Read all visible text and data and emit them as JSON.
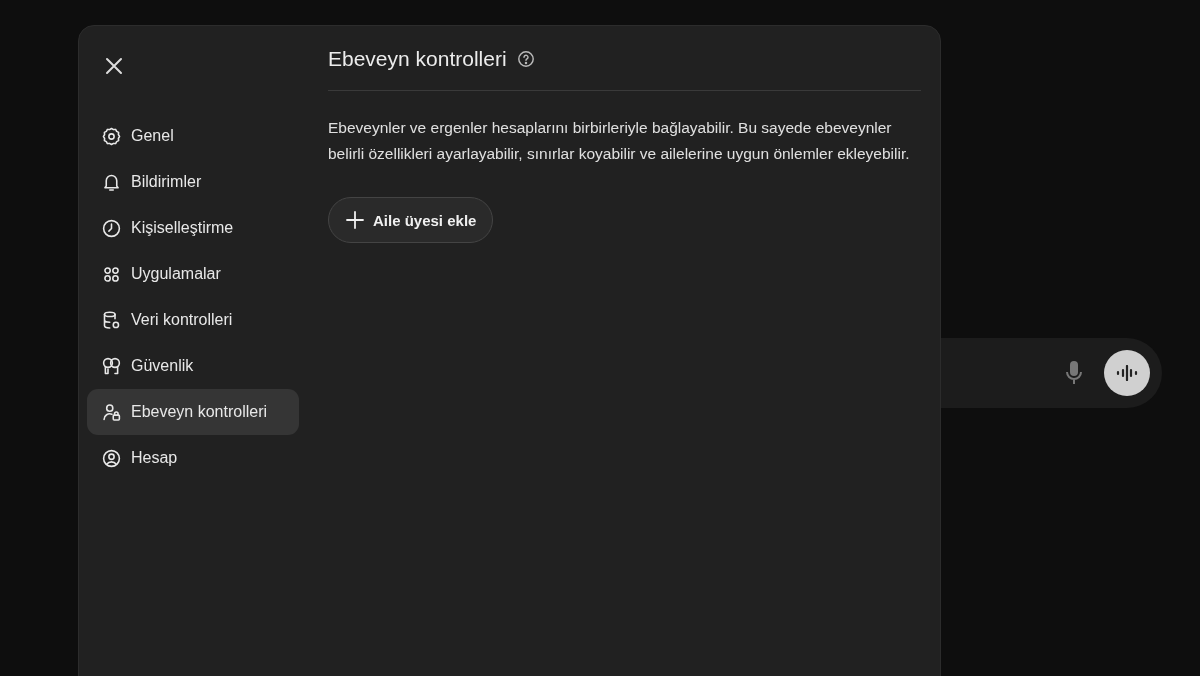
{
  "sidebar": {
    "items": [
      {
        "label": "Genel",
        "selected": false
      },
      {
        "label": "Bildirimler",
        "selected": false
      },
      {
        "label": "Kişiselleştirme",
        "selected": false
      },
      {
        "label": "Uygulamalar",
        "selected": false
      },
      {
        "label": "Veri kontrolleri",
        "selected": false
      },
      {
        "label": "Güvenlik",
        "selected": false
      },
      {
        "label": "Ebeveyn kontrolleri",
        "selected": true
      },
      {
        "label": "Hesap",
        "selected": false
      }
    ]
  },
  "panel": {
    "title": "Ebeveyn kontrolleri",
    "description": "Ebeveynler ve ergenler hesaplarını birbirleriyle bağlayabilir. Bu sayede ebeveynler belirli özellikleri ayarlayabilir, sınırlar koyabilir ve ailelerine uygun önlemler ekleyebilir.",
    "button": "Aile üyesi ekle"
  }
}
